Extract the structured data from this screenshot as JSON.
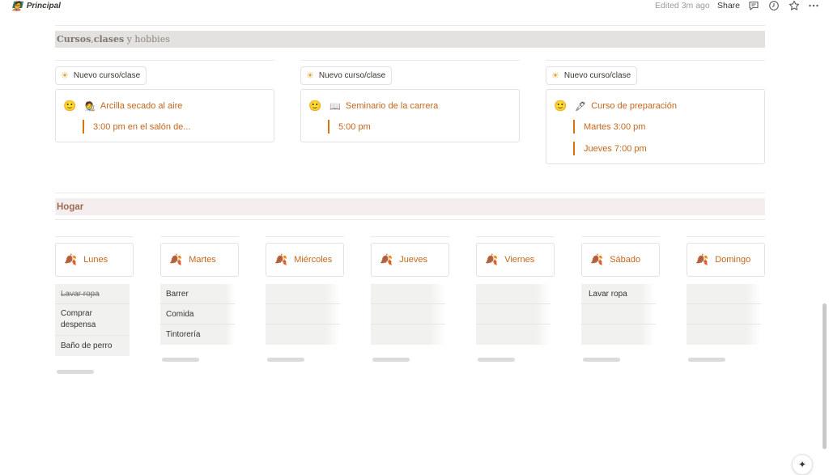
{
  "topbar": {
    "page_emoji": "🧑‍🏫",
    "page_title": "Principal",
    "edited": "Edited 3m ago",
    "share": "Share",
    "icons": [
      "comment-icon",
      "history-icon",
      "star-icon",
      "more-icon"
    ]
  },
  "sections": {
    "cursos": {
      "parts": [
        "Cursos",
        ", ",
        "clases",
        " y ",
        "hobbies"
      ]
    },
    "hogar": {
      "title": "Hogar"
    }
  },
  "courses": {
    "new_label": "Nuevo curso/clase",
    "new_icon": "☀",
    "face_icon": "🙂",
    "columns": [
      {
        "emoji": "🧑‍🎨",
        "title": "Arcilla secado al aire",
        "items": [
          "3:00 pm en el salón de..."
        ]
      },
      {
        "emoji": "📖",
        "title": "Seminario de la carrera",
        "items": [
          "5:00 pm"
        ]
      },
      {
        "emoji": "🖋",
        "title": "Curso de preparación",
        "items": [
          "Martes 3:00 pm",
          "Jueves 7:00 pm"
        ]
      }
    ]
  },
  "days": {
    "leaf_icon": "🍂",
    "columns": [
      {
        "name": "Lunes",
        "tasks": [
          {
            "text": "Lavar ropa",
            "done": true
          },
          {
            "text": "Comprar despensa",
            "done": false
          },
          {
            "text": "Baño de perro",
            "done": false
          }
        ]
      },
      {
        "name": "Martes",
        "tasks": [
          {
            "text": "Barrer",
            "done": false
          },
          {
            "text": "Comida",
            "done": false
          },
          {
            "text": "Tintorería",
            "done": false
          }
        ]
      },
      {
        "name": "Miércoles",
        "tasks": []
      },
      {
        "name": "Jueves",
        "tasks": []
      },
      {
        "name": "Viernes",
        "tasks": []
      },
      {
        "name": "Sábado",
        "tasks": [
          {
            "text": "Lavar ropa",
            "done": false
          }
        ]
      },
      {
        "name": "Domingo",
        "tasks": []
      }
    ]
  },
  "fab_icon": "✦",
  "colors": {
    "accent": "#c4661f",
    "accent_border": "#d9730d",
    "hogar_bg": "#f4eeee",
    "cursos_bg": "#e3e2e0"
  }
}
